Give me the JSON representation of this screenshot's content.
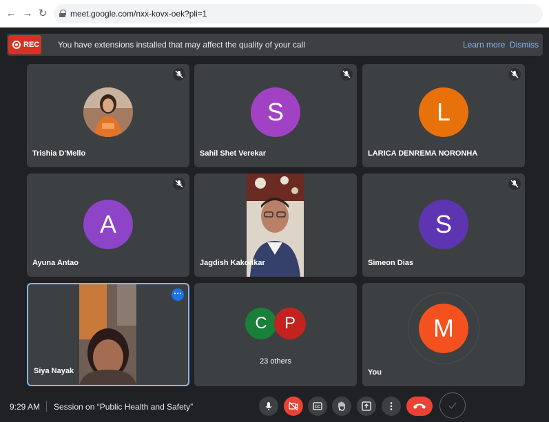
{
  "browser": {
    "url": "meet.google.com/nxx-kovx-oek?pli=1"
  },
  "banner": {
    "rec_label": "REC",
    "message": "You have extensions installed that may affect the quality of your call",
    "learn_more": "Learn more",
    "dismiss": "Dismiss"
  },
  "participants": [
    {
      "name": "Trishia D'Mello",
      "muted": true,
      "media": "profile-photo"
    },
    {
      "name": "Sahil Shet Verekar",
      "initial": "S",
      "color": "#a142c4",
      "muted": true
    },
    {
      "name": "LARICA DENREMA NORONHA",
      "initial": "L",
      "color": "#e8710a",
      "muted": true
    },
    {
      "name": "Ayuna Antao",
      "initial": "A",
      "color": "#8e44c6",
      "muted": true
    },
    {
      "name": "Jagdish Kakodkar",
      "muted": false,
      "media": "video"
    },
    {
      "name": "Simeon Dias",
      "initial": "S",
      "color": "#5e35b1",
      "muted": true
    },
    {
      "name": "Siya Nayak",
      "muted": false,
      "media": "video",
      "active": true
    },
    {
      "others_label": "23 others",
      "avatars": [
        {
          "initial": "C",
          "color": "#188038"
        },
        {
          "initial": "P",
          "color": "#c5221f"
        }
      ]
    },
    {
      "name": "You",
      "initial": "M",
      "color": "#f4511e"
    }
  ],
  "bottombar": {
    "time": "9:29 AM",
    "meeting_title": "Session on “Public Health and Safety”",
    "controls": [
      "microphone-icon",
      "camera-off-icon",
      "captions-icon",
      "raise-hand-icon",
      "present-icon",
      "more-options-icon",
      "hang-up-icon"
    ]
  }
}
